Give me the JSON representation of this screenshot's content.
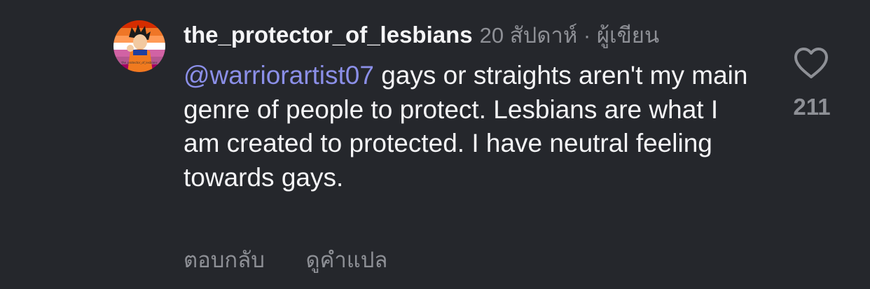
{
  "comment": {
    "username": "the_protector_of_lesbians",
    "meta": "20 สัปดาห์ · ผู้เขียน",
    "mention": "@warriorartist07",
    "text": " gays or straights aren't my main genre of people to protect. Lesbians are what I am created to protected. I have neutral feeling towards gays.",
    "likes": "211",
    "avatar_caption": "the_protector_of_lesbians"
  },
  "actions": {
    "reply_label": "ตอบกลับ",
    "translate_label": "ดูคำแปล"
  },
  "colors": {
    "background": "#25272c",
    "text": "#f5f5f7",
    "muted": "#8e9096",
    "mention": "#8b8fe8",
    "lesbian_flag": [
      "#d52d00",
      "#ef7627",
      "#ff9a56",
      "#ffffff",
      "#d162a4",
      "#b55690",
      "#a30262"
    ]
  },
  "icons": {
    "like": "heart-outline-icon"
  }
}
